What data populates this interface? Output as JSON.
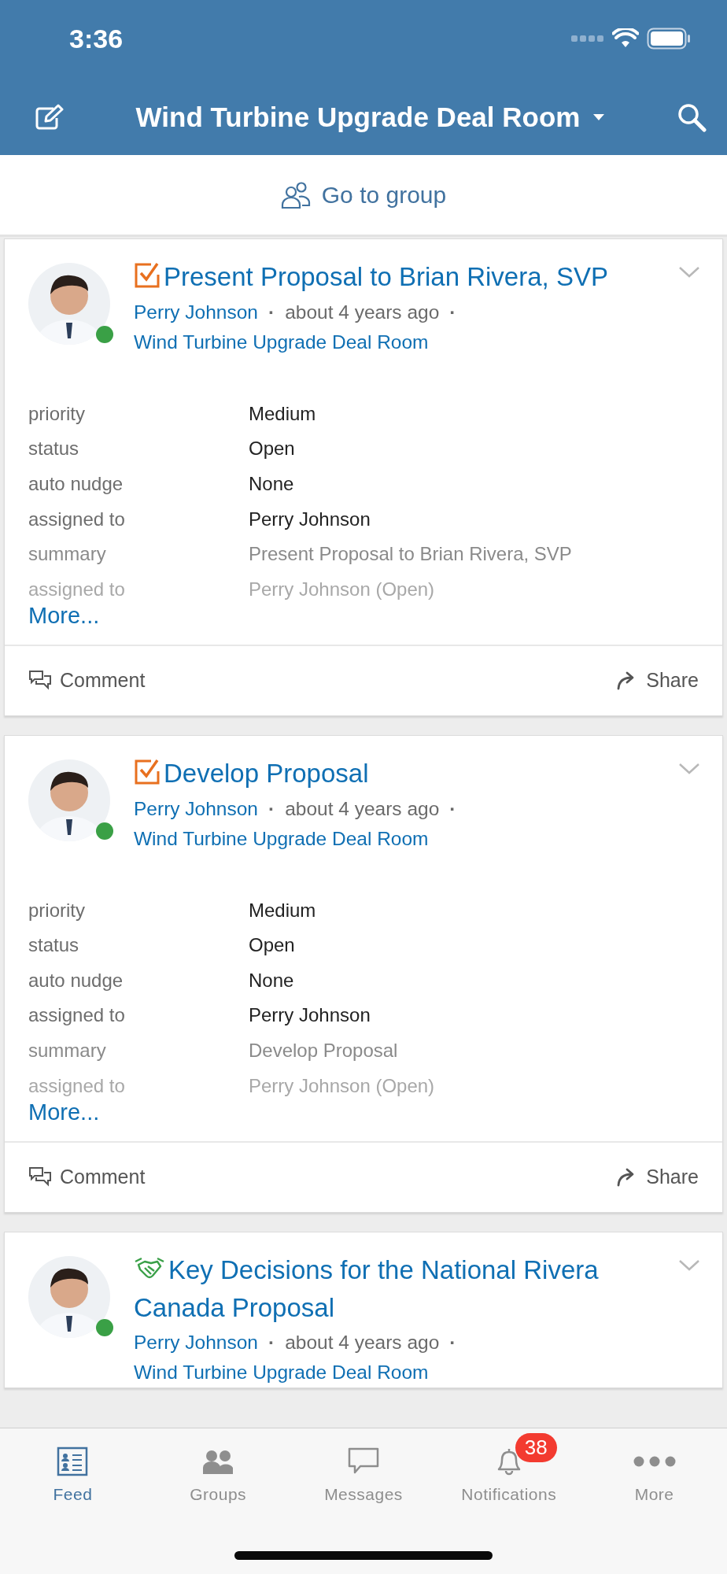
{
  "status_bar": {
    "time": "3:36"
  },
  "nav_bar": {
    "title": "Wind Turbine Upgrade Deal Room"
  },
  "group_link": {
    "label": "Go to group"
  },
  "posts": [
    {
      "kind": "task",
      "title": "Present Proposal to Brian Rivera, SVP",
      "online": true,
      "author": "Perry Johnson",
      "separator": "·",
      "time": "about 4 years ago",
      "group": "Wind Turbine Upgrade Deal Room",
      "fields": [
        {
          "label": "priority",
          "value": "Medium"
        },
        {
          "label": "status",
          "value": "Open"
        },
        {
          "label": "auto nudge",
          "value": "None"
        },
        {
          "label": "assigned to",
          "value": "Perry Johnson"
        },
        {
          "label": "summary",
          "value": "Present Proposal to Brian Rivera, SVP"
        },
        {
          "label": "assigned to",
          "value": "Perry Johnson (Open)"
        }
      ],
      "more": "More...",
      "actions": [
        "Comment",
        "Share"
      ]
    },
    {
      "kind": "task",
      "title": "Develop Proposal",
      "online": true,
      "author": "Perry Johnson",
      "separator": "·",
      "time": "about 4 years ago",
      "group": "Wind Turbine Upgrade Deal Room",
      "fields": [
        {
          "label": "priority",
          "value": "Medium"
        },
        {
          "label": "status",
          "value": "Open"
        },
        {
          "label": "auto nudge",
          "value": "None"
        },
        {
          "label": "assigned to",
          "value": "Perry Johnson"
        },
        {
          "label": "summary",
          "value": "Develop Proposal"
        },
        {
          "label": "assigned to",
          "value": "Perry Johnson (Open)"
        }
      ],
      "more": "More...",
      "actions": [
        "Comment",
        "Share"
      ]
    },
    {
      "kind": "decision",
      "title": "Key Decisions for the National Rivera Canada Proposal",
      "online": true,
      "author": "Perry Johnson",
      "separator": "·",
      "time": "about 4 years ago",
      "group": "Wind Turbine Upgrade Deal Room"
    }
  ],
  "tab_bar": {
    "tabs": [
      {
        "kind": "feed",
        "label": "Feed",
        "selected": true
      },
      {
        "kind": "groups",
        "label": "Groups",
        "selected": false
      },
      {
        "kind": "messages",
        "label": "Messages",
        "selected": false
      },
      {
        "kind": "notifications",
        "label": "Notifications",
        "selected": false,
        "badge": "38"
      },
      {
        "kind": "more",
        "label": "More",
        "selected": false
      }
    ]
  }
}
